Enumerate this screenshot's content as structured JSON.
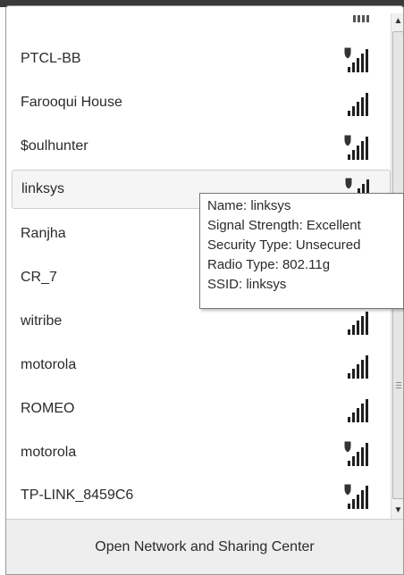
{
  "networks": [
    {
      "name": "PTCL-BB",
      "secured": true,
      "bars": 4
    },
    {
      "name": "Farooqui House",
      "secured": false,
      "bars": 4
    },
    {
      "name": "$oulhunter",
      "secured": true,
      "bars": 4
    },
    {
      "name": "linksys",
      "secured": true,
      "bars": 4,
      "selected": true
    },
    {
      "name": "Ranjha",
      "secured": false,
      "bars": 4
    },
    {
      "name": "CR_7",
      "secured": false,
      "bars": 4
    },
    {
      "name": "witribe",
      "secured": false,
      "bars": 4
    },
    {
      "name": "motorola",
      "secured": false,
      "bars": 4
    },
    {
      "name": "ROMEO",
      "secured": false,
      "bars": 4
    },
    {
      "name": "motorola",
      "secured": true,
      "bars": 4
    },
    {
      "name": "TP-LINK_8459C6",
      "secured": true,
      "bars": 4
    }
  ],
  "tooltip": {
    "name_line": "Name: linksys",
    "signal_line": "Signal Strength: Excellent",
    "security_line": "Security Type: Unsecured",
    "radio_line": "Radio Type: 802.11g",
    "ssid_line": "SSID: linksys"
  },
  "footer": {
    "link_label": "Open Network and Sharing Center"
  },
  "icons": {
    "signal": "wifi-signal-icon",
    "shield": "security-shield-icon",
    "scroll_up": "scroll-up-arrow-icon",
    "scroll_down": "scroll-down-arrow-icon"
  },
  "colors": {
    "bar_dark": "#1f1f1f",
    "bar_light": "#b0b0b0",
    "shield": "#333333"
  }
}
